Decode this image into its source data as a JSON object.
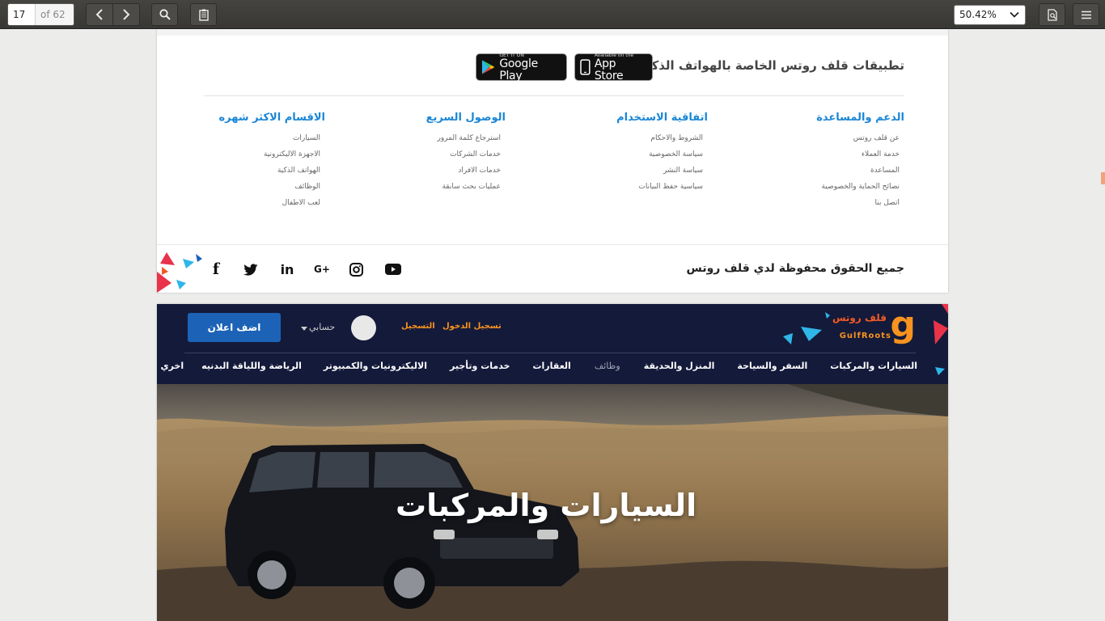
{
  "toolbar": {
    "page_current": "17",
    "page_total": "of 62",
    "zoom": "50.42%"
  },
  "footer": {
    "apps_title": "تطبيقات قلف روتس الخاصة بالهواتف الذكية",
    "app_store": {
      "small": "Available on the",
      "big": "App Store"
    },
    "google_play": {
      "small": "GET IT ON",
      "big": "Google Play"
    },
    "columns": [
      {
        "title": "الدعم والمساعدة",
        "items": [
          "عن قلف روتس",
          "خدمة العملاء",
          "المساعدة",
          "نصائح الحماية والخصوصية",
          "اتصل بنا"
        ]
      },
      {
        "title": "اتفاقية الاستخدام",
        "items": [
          "الشروط والاحكام",
          "سياسة الخصوصية",
          "سياسة النشر",
          "سياسية حفظ البيانات"
        ]
      },
      {
        "title": "الوصول السريع",
        "items": [
          "استرجاع كلمة المرور",
          "خدمات الشركات",
          "خدمات الافراد",
          "عمليات بحث سابقة"
        ]
      },
      {
        "title": "الاقسام الاكثر شهره",
        "items": [
          "السيارات",
          "الاجهزة الاليكترونية",
          "الهواتف الذكية",
          "الوظائف",
          "لعب الاطفال"
        ]
      }
    ],
    "copyright": "جميع الحقوق محفوظة لدي قلف روتس",
    "social_icons": [
      "youtube-icon",
      "instagram-icon",
      "google-plus-icon",
      "linkedin-icon",
      "twitter-icon",
      "facebook-icon"
    ],
    "social_glyphs": {
      "gplus": "G+",
      "linkedin": "in",
      "facebook": "f"
    }
  },
  "site": {
    "logo_ar": "قلف روتس",
    "logo_en": "GulfRoots",
    "logo_g": "g",
    "login": "تسجيل الدخول",
    "register": "التسجيل",
    "account": "حسابي",
    "post_ad": "اضف اعلان",
    "nav": [
      "السيارات والمركبات",
      "السفر والسياحة",
      "المنزل والحديقة",
      "وظائف",
      "العقارات",
      "خدمات وتأجير",
      "الاليكترونيات والكمبيوتر",
      "الرياضة واللياقة البدنيه",
      "اخري"
    ],
    "hero_title": "السيارات والمركبات"
  },
  "colors": {
    "accent_blue": "#1a86d6",
    "brand_orange": "#f7931e",
    "header_bg": "#141a3a",
    "button_blue": "#1c63b7"
  }
}
